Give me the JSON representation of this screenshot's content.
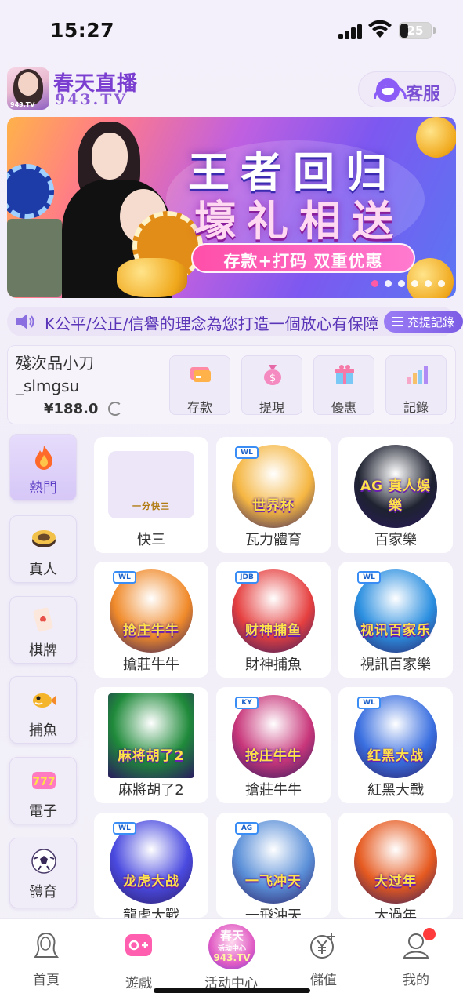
{
  "status_bar": {
    "time": "15:27",
    "battery": "25"
  },
  "header": {
    "logo_title": "春天直播",
    "logo_subtitle": "943.TV",
    "logo_badge": "943.TV",
    "service_label": "客服"
  },
  "banner": {
    "title_line1": "王者回归",
    "title_line2": "壕礼相送",
    "promo": "存款+打码 双重优惠",
    "slide_count": 6,
    "active_slide": 1
  },
  "marquee": {
    "text": "K公平/公正/信譽的理念為您打造一個放心有保障",
    "records_label": "充提記錄"
  },
  "account": {
    "username": "殘次品小刀_slmgsu",
    "balance": "¥188.0",
    "actions": [
      {
        "label": "存款",
        "icon": "card-icon"
      },
      {
        "label": "提現",
        "icon": "money-bag-icon"
      },
      {
        "label": "優惠",
        "icon": "gift-icon"
      },
      {
        "label": "記錄",
        "icon": "bar-chart-icon"
      }
    ]
  },
  "categories": [
    {
      "label": "熱門",
      "icon": "flame-icon",
      "active": true
    },
    {
      "label": "真人",
      "icon": "poker-chip-icon"
    },
    {
      "label": "棋牌",
      "icon": "playing-card-icon"
    },
    {
      "label": "捕魚",
      "icon": "fish-icon"
    },
    {
      "label": "電子",
      "icon": "slot-777-icon"
    },
    {
      "label": "體育",
      "icon": "soccer-ball-icon"
    }
  ],
  "games": [
    {
      "label": "快三",
      "art_text": "一分快三",
      "provider": "",
      "color": "#ece6f8"
    },
    {
      "label": "瓦力體育",
      "art_text": "世界杯",
      "provider": "WL",
      "color": "#f5b642"
    },
    {
      "label": "百家樂",
      "art_text": "AG 真人娛樂",
      "provider": "",
      "color": "#1e2230"
    },
    {
      "label": "搶莊牛牛",
      "art_text": "抢庄牛牛",
      "provider": "WL",
      "color": "#f08a2a"
    },
    {
      "label": "財神捕魚",
      "art_text": "财神捕鱼",
      "provider": "JDB",
      "color": "#e64040"
    },
    {
      "label": "視訊百家樂",
      "art_text": "视讯百家乐",
      "provider": "WL",
      "color": "#2b8fe0"
    },
    {
      "label": "麻將胡了2",
      "art_text": "麻将胡了2",
      "provider": "",
      "color": "#1f8a3a"
    },
    {
      "label": "搶莊牛牛",
      "art_text": "抢庄牛牛",
      "provider": "KY",
      "color": "#c8367a"
    },
    {
      "label": "紅黑大戰",
      "art_text": "红黑大战",
      "provider": "WL",
      "color": "#3a6fe0"
    },
    {
      "label": "龍虎大戰",
      "art_text": "龙虎大战",
      "provider": "WL",
      "color": "#4a4ae0"
    },
    {
      "label": "一飛沖天",
      "art_text": "一飞冲天",
      "provider": "AG",
      "color": "#5a8fd8"
    },
    {
      "label": "大過年",
      "art_text": "大过年",
      "provider": "",
      "color": "#e65a20"
    }
  ],
  "tabbar": {
    "items": [
      {
        "label": "首頁",
        "icon": "home-avatar-icon"
      },
      {
        "label": "遊戲",
        "icon": "gamepad-icon"
      },
      {
        "label": "活动中心",
        "icon": "event-center-logo-icon"
      },
      {
        "label": "儲值",
        "icon": "yen-plus-icon"
      },
      {
        "label": "我的",
        "icon": "profile-icon"
      }
    ],
    "center_logo_line1": "春天",
    "center_logo_line2": "活动中心",
    "center_logo_line3": "943.TV"
  },
  "colors": {
    "accent": "#7b4fd4",
    "brand_pink": "#ff5aa5",
    "badge_red": "#ff3b3b"
  }
}
